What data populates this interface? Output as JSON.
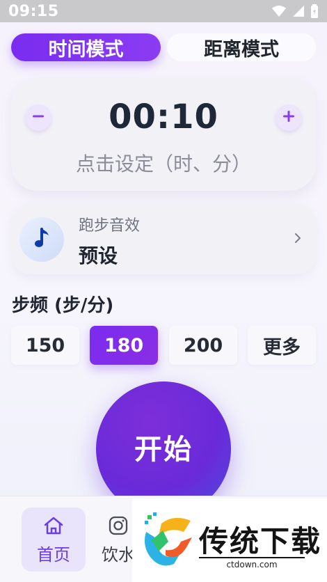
{
  "status_bar": {
    "time": "09:15",
    "icons": [
      "wifi-icon",
      "signal-icon",
      "battery-icon"
    ]
  },
  "mode_tabs": [
    {
      "label": "时间模式",
      "active": true
    },
    {
      "label": "距离模式",
      "active": false
    }
  ],
  "timer": {
    "value": "00:10",
    "hint": "点击设定（时、分）",
    "minus_icon": "minus-icon",
    "plus_icon": "plus-icon"
  },
  "sound": {
    "title": "跑步音效",
    "value": "预设",
    "icon": "music-note-icon"
  },
  "cadence": {
    "label": "步频 (步/分)",
    "options": [
      {
        "label": "150",
        "active": false
      },
      {
        "label": "180",
        "active": true
      },
      {
        "label": "200",
        "active": false
      },
      {
        "label": "更多",
        "active": false
      }
    ]
  },
  "start_button": {
    "label": "开始"
  },
  "bottom_nav": {
    "items": [
      {
        "label": "首页",
        "icon": "home-icon",
        "active": true
      },
      {
        "label": "饮水",
        "icon": "camera-icon",
        "active": false
      }
    ]
  },
  "watermark": {
    "title": "传统下载",
    "subtitle": "ctdown.com"
  },
  "colors": {
    "accent": "#7a2cf0",
    "accent_blue": "#4c4be0",
    "background": "#f6f2fd"
  }
}
